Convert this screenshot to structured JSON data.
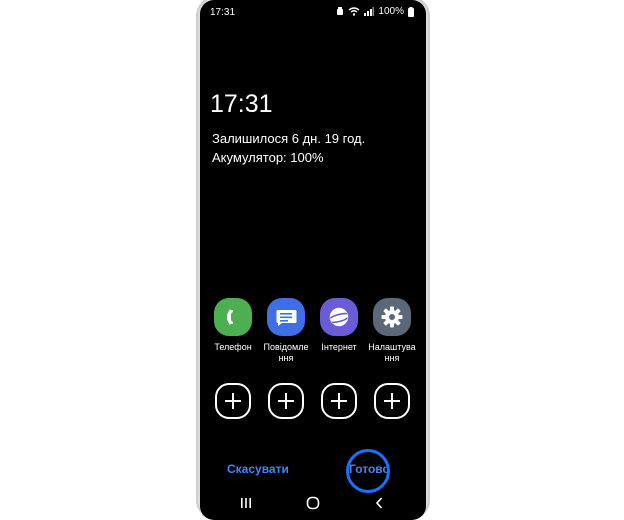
{
  "status": {
    "time": "17:31",
    "battery": "100%"
  },
  "lockscreen": {
    "clock": "17:31",
    "remaining": "Залишилося 6 дн. 19 год.",
    "battery_line": "Акумулятор: 100%"
  },
  "apps": [
    {
      "label": "Телефон",
      "icon": "phone-icon",
      "color": "#4caf50"
    },
    {
      "label": "Повідомле ння",
      "icon": "messages-icon",
      "color": "#3f6ee8"
    },
    {
      "label": "Інтернет",
      "icon": "internet-icon",
      "color": "#6a5bd6"
    },
    {
      "label": "Налаштува ння",
      "icon": "settings-icon",
      "color": "#5b6878"
    }
  ],
  "actions": {
    "cancel": "Скасувати",
    "done": "Готово"
  },
  "colors": {
    "accent": "#3f87f5",
    "highlight": "#1d6fff"
  }
}
